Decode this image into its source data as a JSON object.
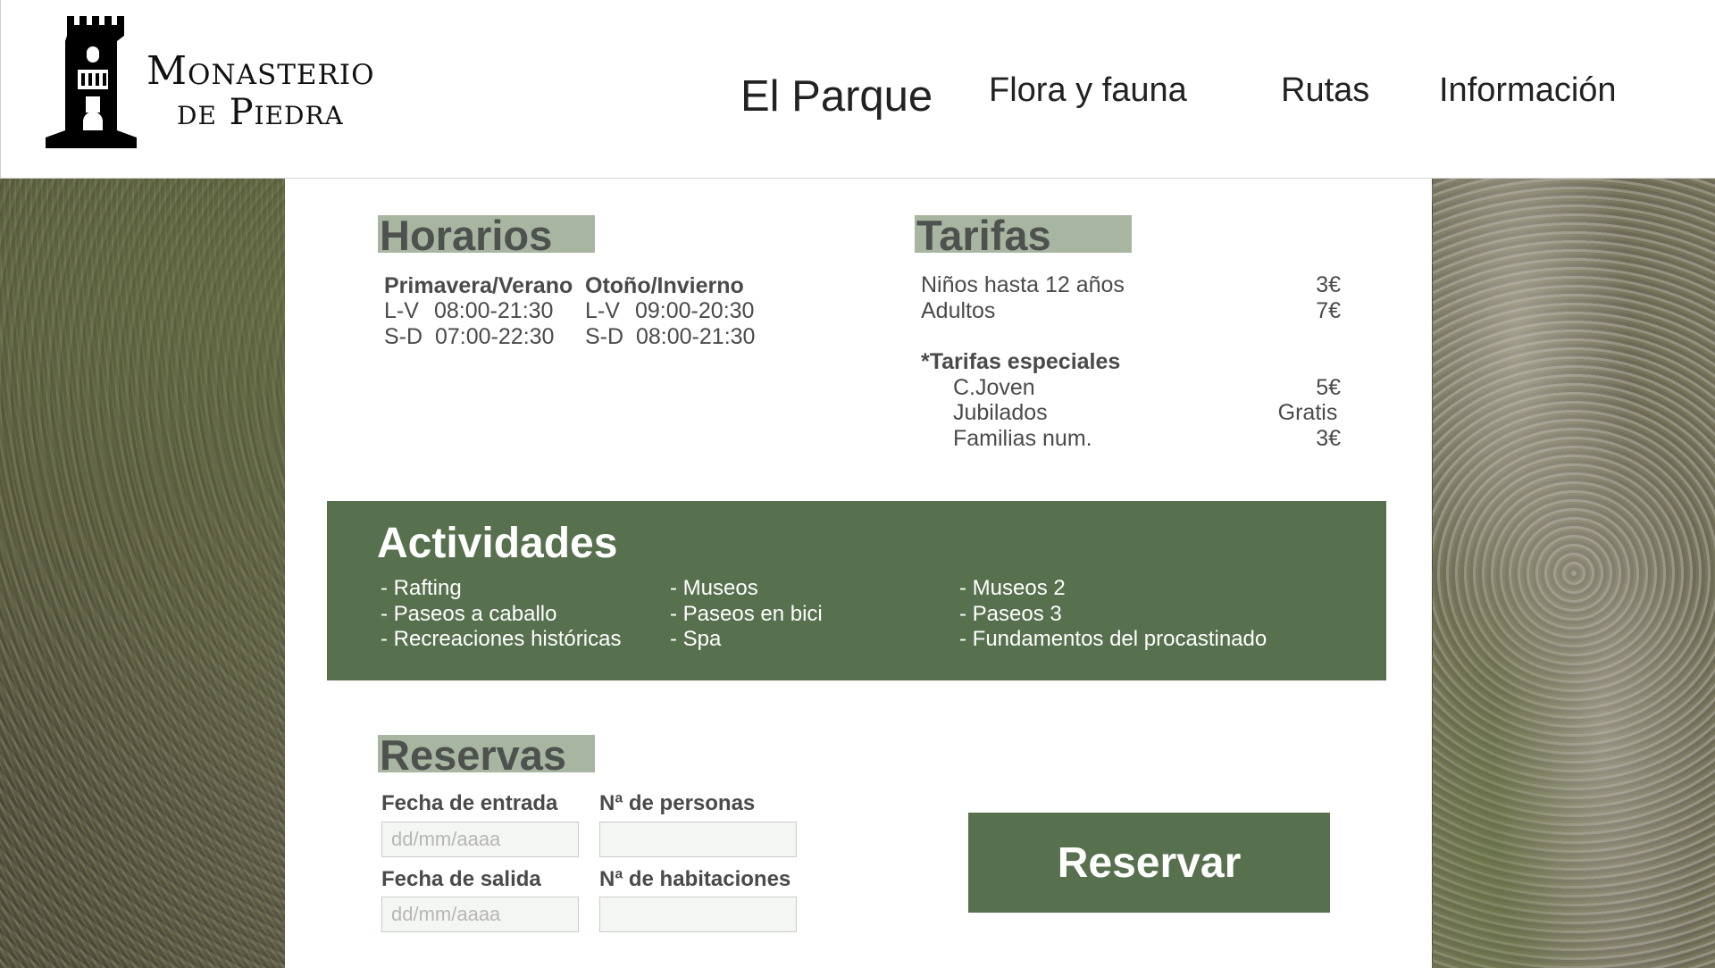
{
  "brand": {
    "name_line1": "Monasterio",
    "name_line2": "de Piedra",
    "logo_icon": "tower-icon"
  },
  "nav": {
    "items": [
      {
        "label": "El Parque"
      },
      {
        "label": "Flora y fauna"
      },
      {
        "label": "Rutas"
      },
      {
        "label": "Información"
      }
    ]
  },
  "horarios": {
    "title": "Horarios",
    "seasons": [
      {
        "name": "Primavera/Verano",
        "rows": [
          {
            "days": "L-V",
            "hours": "08:00-21:30"
          },
          {
            "days": "S-D",
            "hours": "07:00-22:30"
          }
        ]
      },
      {
        "name": "Otoño/Invierno",
        "rows": [
          {
            "days": "L-V",
            "hours": "09:00-20:30"
          },
          {
            "days": "S-D",
            "hours": "08:00-21:30"
          }
        ]
      }
    ]
  },
  "tarifas": {
    "title": "Tarifas",
    "rows": [
      {
        "label": "Niños hasta 12 años",
        "price": "3€"
      },
      {
        "label": "Adultos",
        "price": "7€"
      }
    ],
    "special_title": "*Tarifas especiales",
    "special_rows": [
      {
        "label": "C.Joven",
        "price": "5€"
      },
      {
        "label": "Jubilados",
        "price": "Gratis"
      },
      {
        "label": "Familias num.",
        "price": "3€"
      }
    ]
  },
  "actividades": {
    "title": "Actividades",
    "columns": [
      [
        "- Rafting",
        "- Paseos a caballo",
        "- Recreaciones históricas"
      ],
      [
        "- Museos",
        "- Paseos en bici",
        "- Spa"
      ],
      [
        "- Museos 2",
        "- Paseos 3",
        "- Fundamentos del procastinado"
      ]
    ]
  },
  "reservas": {
    "title": "Reservas",
    "entry_label": "Fecha de entrada",
    "entry_placeholder": "dd/mm/aaaa",
    "exit_label": "Fecha de salida",
    "exit_placeholder": "dd/mm/aaaa",
    "persons_label": "Nª de personas",
    "rooms_label": "Nª de habitaciones",
    "button_label": "Reservar"
  },
  "colors": {
    "accent_green": "#57704e",
    "title_highlight": "#a8b5a1"
  }
}
